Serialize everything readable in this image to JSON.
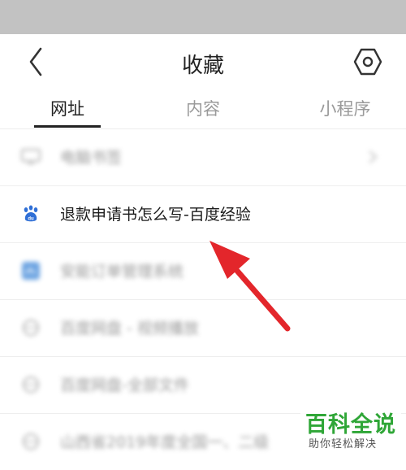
{
  "header": {
    "title": "收藏",
    "back_icon": "chevron-left-icon",
    "settings_icon": "hexagon-gear-icon"
  },
  "tabs": [
    {
      "label": "网址",
      "active": true
    },
    {
      "label": "内容",
      "active": false
    },
    {
      "label": "小程序",
      "active": false
    }
  ],
  "list": {
    "items": [
      {
        "label": "电脑书签",
        "icon": "monitor-icon"
      },
      {
        "label": "退款申请书怎么写-百度经验",
        "icon": "baidu-paw-icon"
      },
      {
        "label": "安能订单管理系统",
        "icon": "app-icon"
      },
      {
        "label": "百度网盘 - 视频播放",
        "icon": "globe-icon"
      },
      {
        "label": "百度网盘-全部文件",
        "icon": "globe-icon"
      },
      {
        "label": "山西省2019年度全国一、二级",
        "icon": "globe-icon"
      }
    ]
  },
  "watermark": {
    "main": "百科全说",
    "sub": "助你轻松解决"
  },
  "colors": {
    "accent_arrow": "#e3262b",
    "watermark_green": "#2fa637",
    "status_bar": "#c2c2c2"
  }
}
